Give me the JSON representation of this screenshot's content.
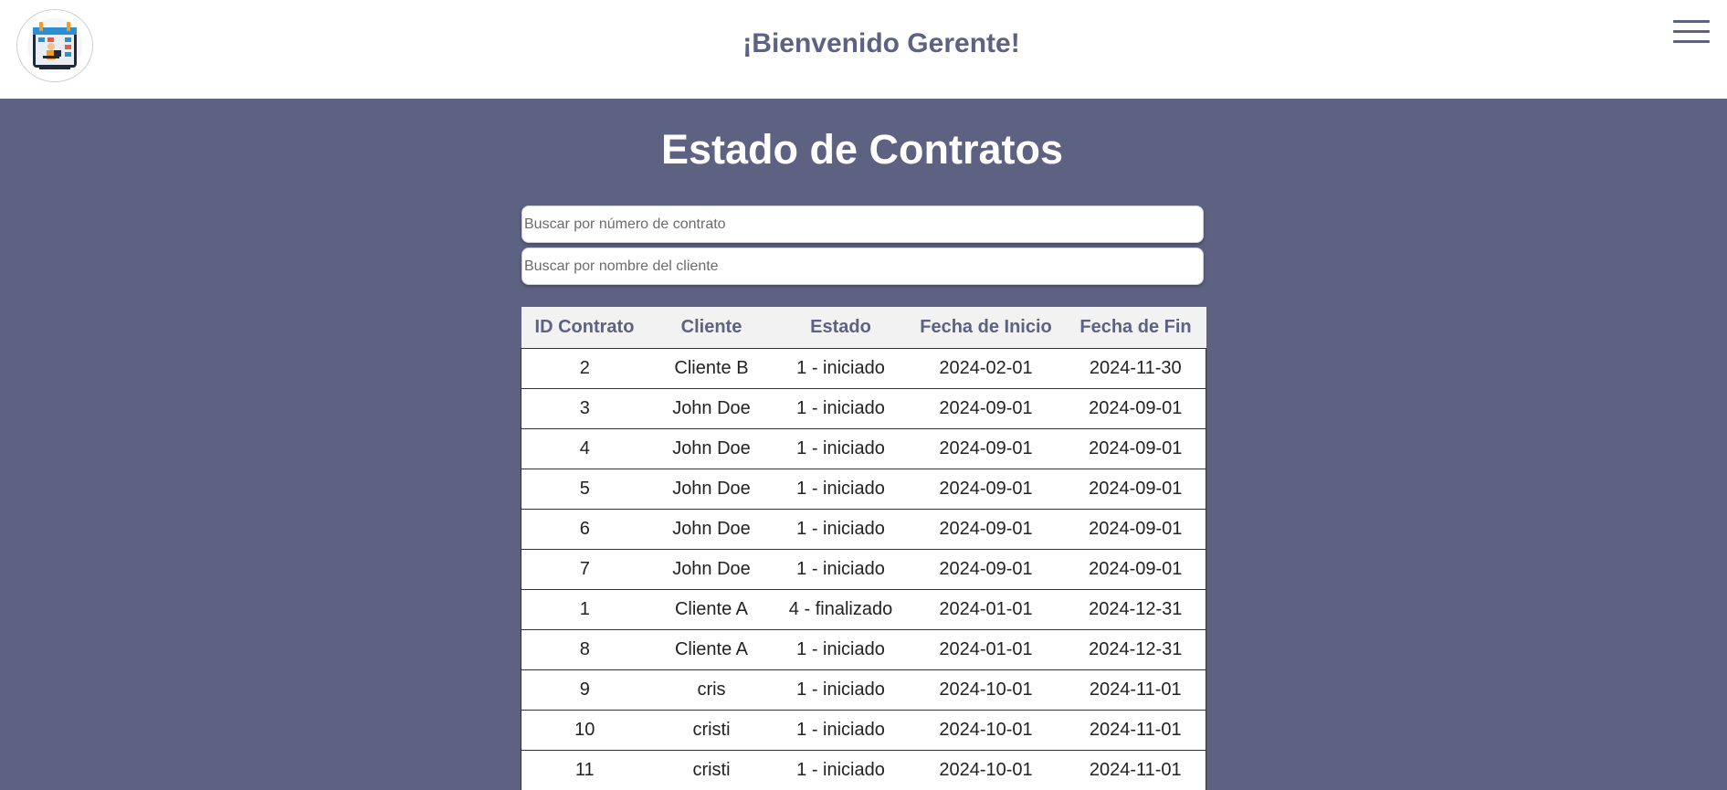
{
  "header": {
    "welcome": "¡Bienvenido Gerente!",
    "logo_icon": "calendar-worker-logo-icon",
    "menu_icon": "hamburger-menu-icon"
  },
  "main": {
    "title": "Estado de Contratos",
    "search_contract_placeholder": "Buscar por número de contrato",
    "search_client_placeholder": "Buscar por nombre del cliente"
  },
  "table": {
    "columns": [
      "ID Contrato",
      "Cliente",
      "Estado",
      "Fecha de Inicio",
      "Fecha de Fin"
    ],
    "rows": [
      [
        "2",
        "Cliente B",
        "1 - iniciado",
        "2024-02-01",
        "2024-11-30"
      ],
      [
        "3",
        "John Doe",
        "1 - iniciado",
        "2024-09-01",
        "2024-09-01"
      ],
      [
        "4",
        "John Doe",
        "1 - iniciado",
        "2024-09-01",
        "2024-09-01"
      ],
      [
        "5",
        "John Doe",
        "1 - iniciado",
        "2024-09-01",
        "2024-09-01"
      ],
      [
        "6",
        "John Doe",
        "1 - iniciado",
        "2024-09-01",
        "2024-09-01"
      ],
      [
        "7",
        "John Doe",
        "1 - iniciado",
        "2024-09-01",
        "2024-09-01"
      ],
      [
        "1",
        "Cliente A",
        "4 - finalizado",
        "2024-01-01",
        "2024-12-31"
      ],
      [
        "8",
        "Cliente A",
        "1 - iniciado",
        "2024-01-01",
        "2024-12-31"
      ],
      [
        "9",
        "cris",
        "1 - iniciado",
        "2024-10-01",
        "2024-11-01"
      ],
      [
        "10",
        "cristi",
        "1 - iniciado",
        "2024-10-01",
        "2024-11-01"
      ],
      [
        "11",
        "cristi",
        "1 - iniciado",
        "2024-10-01",
        "2024-11-01"
      ]
    ]
  },
  "colors": {
    "primary": "#5d6182",
    "header_bg": "#ffffff",
    "table_header_bg": "#f2f2f2"
  }
}
